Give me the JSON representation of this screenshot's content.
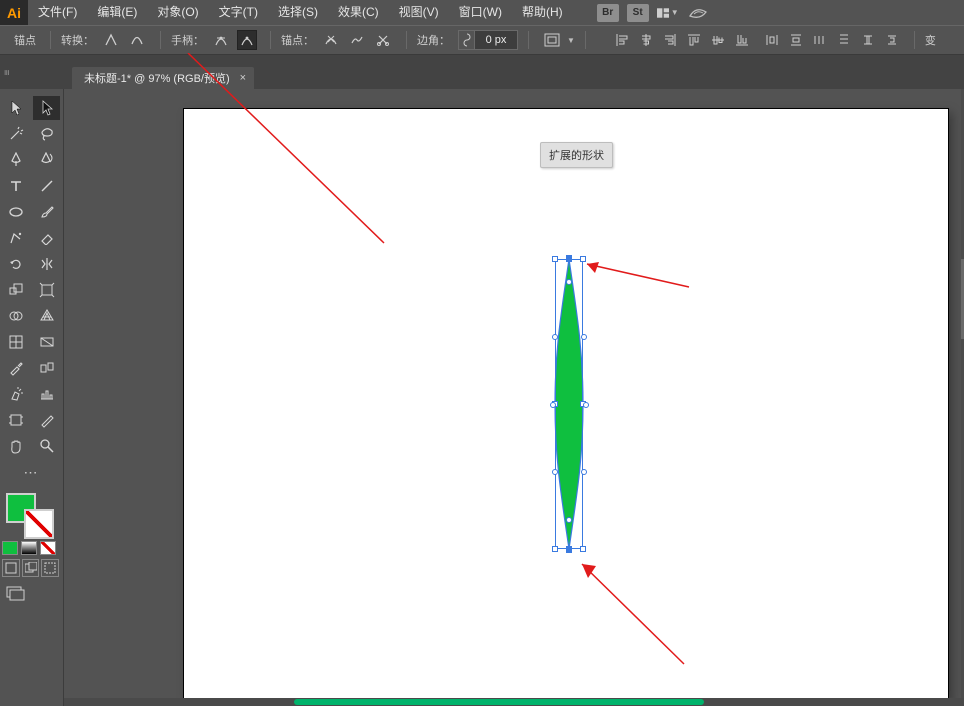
{
  "app_logo_text": "Ai",
  "menu": {
    "file": "文件(F)",
    "edit": "编辑(E)",
    "object": "对象(O)",
    "type": "文字(T)",
    "select": "选择(S)",
    "effect": "效果(C)",
    "view": "视图(V)",
    "window": "窗口(W)",
    "help": "帮助(H)"
  },
  "menubar_icons": {
    "bridge_label": "Br",
    "stock_label": "St"
  },
  "ctrlbar": {
    "anchor_label": "锚点",
    "convert_label": "转换：",
    "handles_label": "手柄：",
    "anchors_label": "锚点：",
    "corner_label": "边角：",
    "corner_value": "0 px",
    "transform_label": "变"
  },
  "tab": {
    "title": "未标题-1* @ 97% (RGB/预览)",
    "close_glyph": "×"
  },
  "chip_label": "扩展的形状",
  "colors": {
    "fill_hex": "#0fbf3f",
    "selection_blue": "#3a7ae0",
    "arrow_red": "#e11b1b"
  },
  "mini_swatches": [
    "#0fbf3f",
    "#ffffff",
    "#e00000"
  ],
  "chart_data": null
}
